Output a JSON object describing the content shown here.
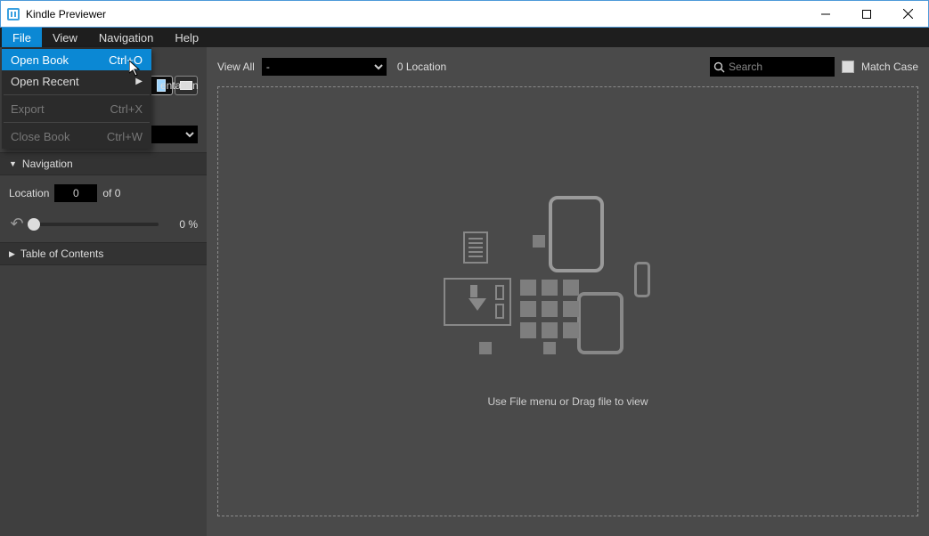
{
  "window": {
    "title": "Kindle Previewer"
  },
  "menubar": {
    "file": "File",
    "view": "View",
    "navigation": "Navigation",
    "help": "Help"
  },
  "file_menu": {
    "open_book": {
      "label": "Open Book",
      "accel": "Ctrl+O"
    },
    "open_recent": {
      "label": "Open Recent"
    },
    "export": {
      "label": "Export",
      "accel": "Ctrl+X"
    },
    "close_book": {
      "label": "Close Book",
      "accel": "Ctrl+W"
    }
  },
  "sidebar": {
    "orientation_label_fragment": "entation",
    "orientation_label_suffix": "e",
    "navigation_header": "Navigation",
    "location_label": "Location",
    "location_value": "0",
    "location_of": "of 0",
    "percent": "0 %",
    "toc_header": "Table of Contents"
  },
  "toolbar": {
    "view_all_label": "View All",
    "view_all_value": "-",
    "location_text": "0 Location",
    "search_placeholder": "Search",
    "match_case_label": "Match Case"
  },
  "dropzone": {
    "hint": "Use File menu or Drag file to view"
  }
}
